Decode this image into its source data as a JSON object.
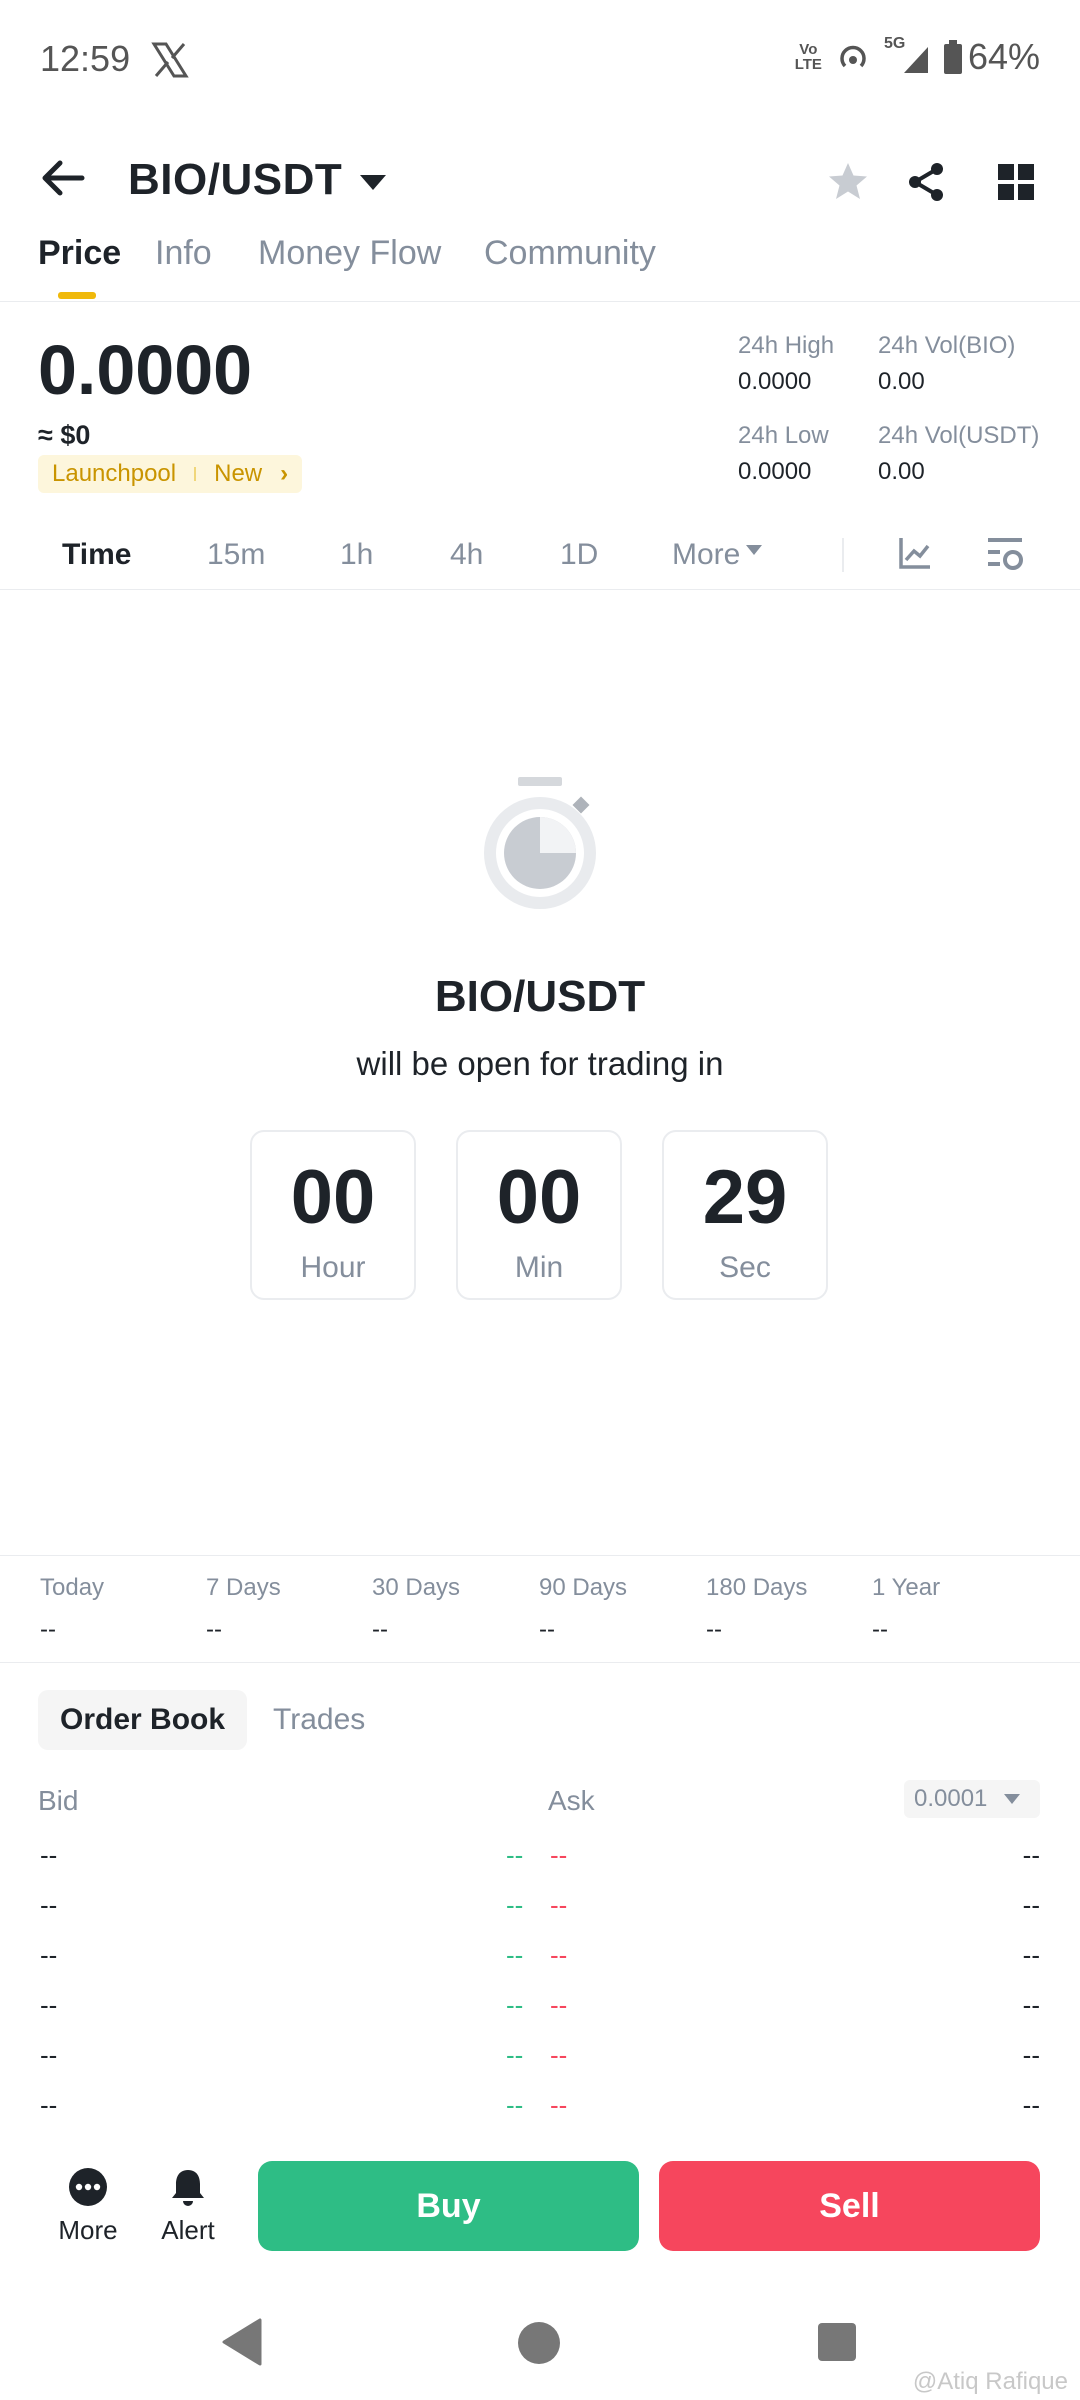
{
  "status_bar": {
    "time": "12:59",
    "volte_top": "Vo",
    "volte_bottom": "LTE",
    "network": "5G",
    "battery": "64%"
  },
  "header": {
    "title": "BIO/USDT"
  },
  "tabs": [
    {
      "label": "Price"
    },
    {
      "label": "Info"
    },
    {
      "label": "Money Flow"
    },
    {
      "label": "Community"
    }
  ],
  "price": {
    "last": "0.0000",
    "usd": "≈ $0",
    "tags": [
      "Launchpool",
      "New"
    ],
    "stats": {
      "high_label": "24h High",
      "high_value": "0.0000",
      "vol_bio_label": "24h Vol(BIO)",
      "vol_bio_value": "0.00",
      "low_label": "24h Low",
      "low_value": "0.0000",
      "vol_usdt_label": "24h Vol(USDT)",
      "vol_usdt_value": "0.00"
    }
  },
  "intervals": [
    "Time",
    "15m",
    "1h",
    "4h",
    "1D",
    "More"
  ],
  "countdown": {
    "pair": "BIO/USDT",
    "subtitle": "will be open for trading in",
    "hour": "00",
    "hour_label": "Hour",
    "min": "00",
    "min_label": "Min",
    "sec": "29",
    "sec_label": "Sec"
  },
  "performance": [
    {
      "label": "Today",
      "value": "--"
    },
    {
      "label": "7 Days",
      "value": "--"
    },
    {
      "label": "30 Days",
      "value": "--"
    },
    {
      "label": "90 Days",
      "value": "--"
    },
    {
      "label": "180 Days",
      "value": "--"
    },
    {
      "label": "1 Year",
      "value": "--"
    }
  ],
  "order_book": {
    "tab_active": "Order Book",
    "tab_other": "Trades",
    "bid_label": "Bid",
    "ask_label": "Ask",
    "precision": "0.0001",
    "placeholder": "--"
  },
  "bottom_bar": {
    "more": "More",
    "alert": "Alert",
    "buy": "Buy",
    "sell": "Sell"
  },
  "watermark": "@Atiq Rafique",
  "colors": {
    "buy": "#2ebd85",
    "sell": "#f6465d",
    "accent": "#f0b90b"
  }
}
